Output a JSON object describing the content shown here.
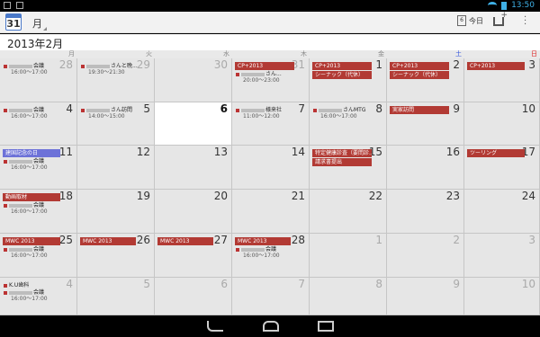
{
  "status": {
    "time": "13:50"
  },
  "app": {
    "icon_label": "31",
    "view_label": "月",
    "today_label": "今日",
    "today_icon_day": "6"
  },
  "header": {
    "title": "2013年2月"
  },
  "weekdays": [
    "月",
    "火",
    "水",
    "木",
    "金",
    "土",
    "日"
  ],
  "colors": {
    "saturday": "#3355dd",
    "sunday": "#dd2222",
    "event_red": "#b23a34",
    "event_blue": "#6d72d8"
  },
  "weeks": [
    {
      "days": [
        "28",
        "29",
        "30",
        "31",
        "1",
        "2",
        "3"
      ]
    },
    {
      "days": [
        "4",
        "5",
        "6",
        "7",
        "8",
        "9",
        "10"
      ]
    },
    {
      "days": [
        "11",
        "12",
        "13",
        "14",
        "15",
        "16",
        "17"
      ]
    },
    {
      "days": [
        "18",
        "19",
        "20",
        "21",
        "22",
        "23",
        "24"
      ]
    },
    {
      "days": [
        "25",
        "26",
        "27",
        "28",
        "1",
        "2",
        "3"
      ]
    },
    {
      "days": [
        "4",
        "5",
        "6",
        "7",
        "8",
        "9",
        "10"
      ]
    }
  ],
  "events": {
    "w0_mon": {
      "title": "会議",
      "time": "16:00～17:00"
    },
    "w0_tue": {
      "title": "さんと晩...",
      "time": "19:30～21:30"
    },
    "w0_thu_bar": "CP+2013",
    "w0_thu": {
      "title": "さん...",
      "time": "20:00～23:00"
    },
    "w0_fri_bar1": "CP+2013",
    "w0_fri_bar2": "シーナック（代休）",
    "w0_sat_bar1": "CP+2013",
    "w0_sat_bar2": "シーナック（代休）",
    "w0_sun_bar": "CP+2013",
    "w1_mon": {
      "title": "会議",
      "time": "16:00～17:00"
    },
    "w1_tue": {
      "title": "さん訪問",
      "time": "14:00～15:00"
    },
    "w1_thu": {
      "title": "様来社",
      "time": "11:00～12:00"
    },
    "w1_fri": {
      "title": "さんMTG",
      "time": "16:00～17:00"
    },
    "w1_sat_bar": "実家訪問",
    "w2_mon_bar": "建国記念の日",
    "w2_mon": {
      "title": "会議",
      "time": "16:00～17:00"
    },
    "w2_fri_bar1": "特定健康診査（要問診...",
    "w2_fri_bar2": "請求書提出",
    "w2_sun_bar": "ツーリング",
    "w3_mon_bar": "動画取材",
    "w3_mon": {
      "title": "会議",
      "time": "16:00～17:00"
    },
    "w4_mon_bar": "MWC 2013",
    "w4_mon": {
      "title": "会議",
      "time": "16:00～17:00"
    },
    "w4_tue_bar": "MWC 2013",
    "w4_wed_bar": "MWC 2013",
    "w4_thu_bar": "MWC 2013",
    "w4_thu": {
      "title": "会議",
      "time": "16:00～17:00"
    },
    "w5_mon": {
      "title": "K.U歯科",
      "time": ""
    },
    "w5_mon2": {
      "title": "会議",
      "time": "16:00～17:00"
    }
  }
}
